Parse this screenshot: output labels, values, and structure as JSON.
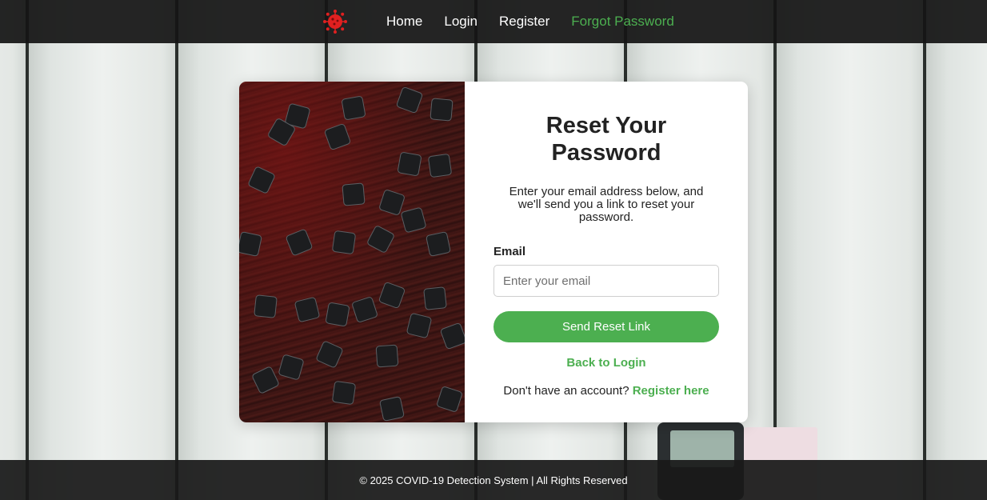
{
  "nav": {
    "logo_icon": "virus-icon",
    "links": [
      {
        "label": "Home"
      },
      {
        "label": "Login"
      },
      {
        "label": "Register"
      },
      {
        "label": "Forgot Password",
        "active": true
      }
    ]
  },
  "form": {
    "title": "Reset Your Password",
    "subtitle": "Enter your email address below, and we'll send you a link to reset your password.",
    "email_label": "Email",
    "email_placeholder": "Enter your email",
    "email_value": "",
    "submit_label": "Send Reset Link",
    "back_link": "Back to Login",
    "register_prompt": "Don't have an account?",
    "register_link": "Register here"
  },
  "footer": {
    "text": "© 2025 COVID-19 Detection System | All Rights Reserved"
  },
  "colors": {
    "accent": "#4caf50",
    "navbar": "#141414",
    "logo": "#e02020"
  }
}
